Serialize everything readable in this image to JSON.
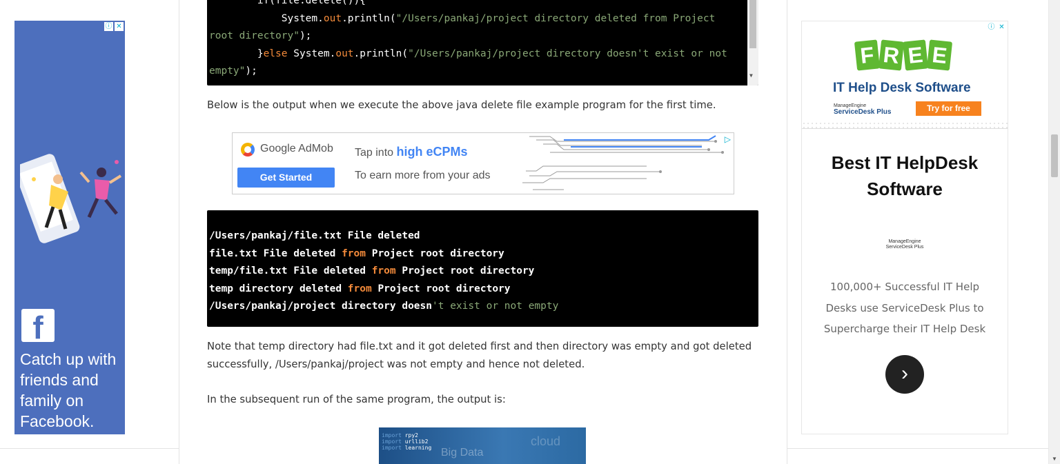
{
  "left_ad": {
    "badge_info": "ⓘ",
    "badge_close": "✕",
    "fb_logo": "f",
    "text": "Catch up with friends and family on Facebook."
  },
  "main": {
    "code_block_1": {
      "line1": "        if(file.delete()){",
      "line2a": "            System.",
      "line2b": "out",
      "line2c": ".println(",
      "line2d": "\"/Users/pankaj/project directory deleted from Project",
      "line3": "root directory\"",
      "line3b": ");",
      "line4a": "        }",
      "line4b": "else",
      "line4c": " System.",
      "line4d": "out",
      "line4e": ".println(",
      "line4f": "\"/Users/pankaj/project directory doesn't exist or not",
      "line5a": "empty\"",
      "line5b": ");"
    },
    "para1": "Below is the output when we execute the above java delete file example program for the first time.",
    "admob": {
      "brand": "Google AdMob",
      "cta": "Get Started",
      "tap_prefix": "Tap into ",
      "tap_highlight": "high eCPMs",
      "earn": "To earn more from your ads"
    },
    "code_block_2": {
      "line1": "/Users/pankaj/file.txt File deleted",
      "line2a": "file.txt File deleted ",
      "line2b": "from",
      "line2c": " Project root directory",
      "line3a": "temp/file.txt File deleted ",
      "line3b": "from",
      "line3c": " Project root directory",
      "line4a": "temp directory deleted ",
      "line4b": "from",
      "line4c": " Project root directory",
      "line5a": "/Users/pankaj/project directory doesn",
      "line5b": "'t exist or not empty"
    },
    "para2": "Note that temp directory had file.txt and it got deleted first and then directory was empty and got deleted successfully, /Users/pankaj/project was not empty and hence not deleted.",
    "para3": "In the subsequent run of the same program, the output is:",
    "thumb": {
      "l1a": "import",
      "l1b": " rpy2",
      "l2a": "import",
      "l2b": " urllib2",
      "l3a": "import",
      "l3b": " learning",
      "big": "Big Data",
      "big2": "cloud"
    }
  },
  "right_ad": {
    "badge_info": "ⓘ",
    "badge_close": "✕",
    "free_letters": [
      "F",
      "R",
      "E",
      "E"
    ],
    "banner_title": "IT Help Desk Software",
    "me_brand_small": "ManageEngine",
    "me_product": "ServiceDesk Plus",
    "try_label": "Try for free",
    "headline": "Best IT HelpDesk Software",
    "logo_brand": "ManageEngine",
    "logo_product": "ServiceDesk Plus",
    "description": "100,000+ Successful IT Help Desks use ServiceDesk Plus to Supercharge their IT Help Desk",
    "next_icon": "›"
  },
  "colors": {
    "facebook_blue": "#4d6fbd",
    "admob_blue": "#4285f4",
    "keyword_orange": "#f38a3a",
    "string_green": "#8aa877",
    "try_orange": "#f7821e",
    "free_green": "#5fb832"
  }
}
